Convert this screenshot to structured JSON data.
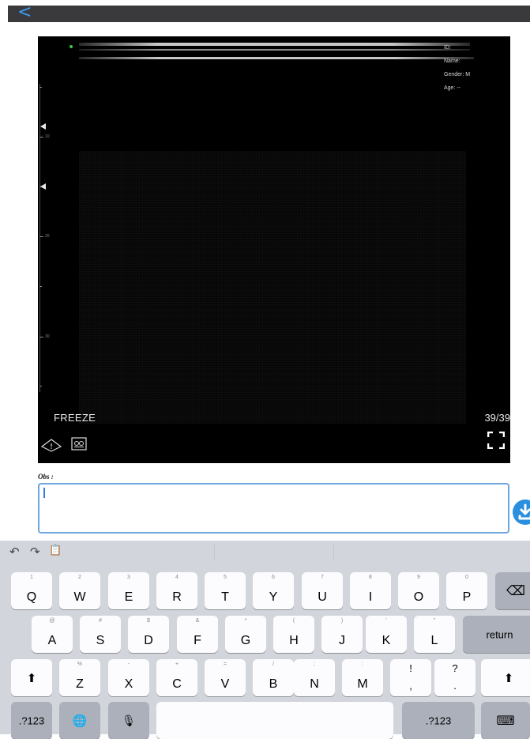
{
  "header": {
    "back_icon": "chevron-left-icon",
    "back_glyph": "<"
  },
  "ultrasound": {
    "patient_info": [
      "ID:",
      "Name:",
      "Gender: M",
      "Age: --"
    ],
    "depth_ticks": [
      "10",
      "20",
      "30"
    ],
    "mode_label": "FREEZE",
    "frame_counter": "39/39",
    "icons": [
      "probe-icon",
      "cine-loop-icon",
      "fullscreen-icon"
    ]
  },
  "observation": {
    "label": "Obs :",
    "value": "",
    "save_icon": "download-icon"
  },
  "keyboard": {
    "toolbar": {
      "undo": "↶",
      "redo": "↷",
      "paste": "📋"
    },
    "row1": [
      {
        "hint": "1",
        "main": "Q"
      },
      {
        "hint": "2",
        "main": "W"
      },
      {
        "hint": "3",
        "main": "E"
      },
      {
        "hint": "4",
        "main": "R"
      },
      {
        "hint": "5",
        "main": "T"
      },
      {
        "hint": "6",
        "main": "Y"
      },
      {
        "hint": "7",
        "main": "U"
      },
      {
        "hint": "8",
        "main": "I"
      },
      {
        "hint": "9",
        "main": "O"
      },
      {
        "hint": "0",
        "main": "P"
      }
    ],
    "row2": [
      {
        "hint": "@",
        "main": "A"
      },
      {
        "hint": "#",
        "main": "S"
      },
      {
        "hint": "$",
        "main": "D"
      },
      {
        "hint": "&",
        "main": "F"
      },
      {
        "hint": "*",
        "main": "G"
      },
      {
        "hint": "(",
        "main": "H"
      },
      {
        "hint": ")",
        "main": "J"
      },
      {
        "hint": "'",
        "main": "K"
      },
      {
        "hint": "\"",
        "main": "L"
      }
    ],
    "row3": [
      {
        "hint": "%",
        "main": "Z"
      },
      {
        "hint": "-",
        "main": "X"
      },
      {
        "hint": "+",
        "main": "C"
      },
      {
        "hint": "=",
        "main": "V"
      },
      {
        "hint": "/",
        "main": "B"
      },
      {
        "hint": ";",
        "main": "N"
      },
      {
        "hint": ":",
        "main": "M"
      }
    ],
    "punct": [
      {
        "top": "!",
        "bottom": ","
      },
      {
        "top": "?",
        "bottom": "."
      }
    ],
    "delete_glyph": "⌫",
    "return_label": "return",
    "shift_glyph": "⬆",
    "numbers_label": ".?123",
    "globe_glyph": "🌐",
    "mic_glyph": "🎙",
    "hide_glyph": "⌨"
  },
  "colors": {
    "accent": "#2a8fde",
    "panel": "#000000",
    "keyboard_bg": "#d2d5db"
  }
}
